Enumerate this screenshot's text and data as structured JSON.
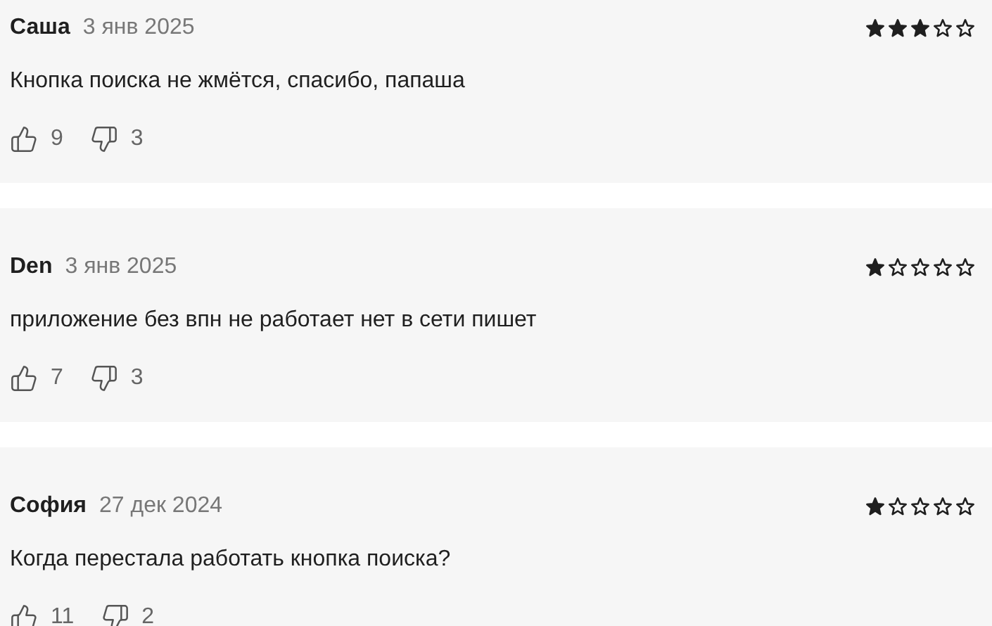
{
  "reviews": [
    {
      "author": "Саша",
      "date": "3 янв 2025",
      "stars": 3,
      "text": "Кнопка поиска не жмётся, спасибо, папаша",
      "likes": "9",
      "dislikes": "3"
    },
    {
      "author": "Den",
      "date": "3 янв 2025",
      "stars": 1,
      "text": "приложение без впн не работает нет в сети пишет",
      "likes": "7",
      "dislikes": "3"
    },
    {
      "author": "София",
      "date": "27 дек 2024",
      "stars": 1,
      "text": "Когда перестала работать кнопка поиска?",
      "likes": "11",
      "dislikes": "2"
    }
  ]
}
